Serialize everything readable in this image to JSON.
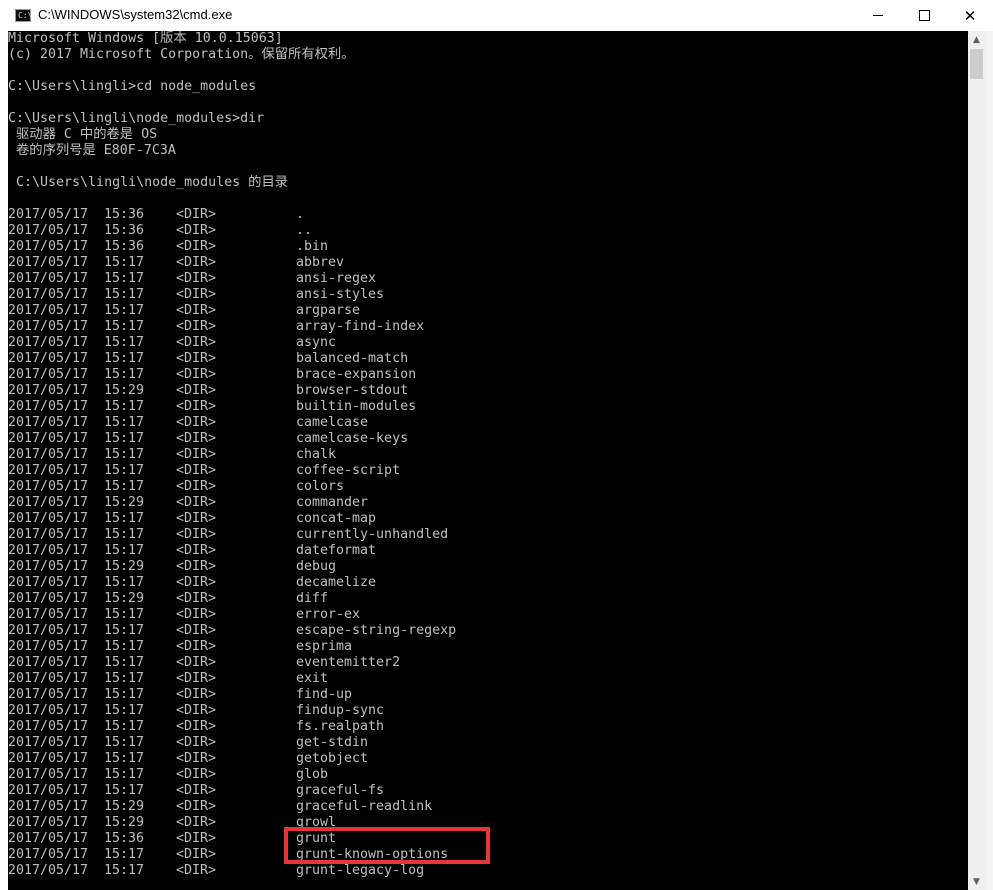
{
  "window": {
    "title": "C:\\WINDOWS\\system32\\cmd.exe",
    "icon": "cmd-icon",
    "icon_glyph": "C:\\",
    "controls": {
      "minimize": "minimize-icon",
      "maximize": "maximize-icon",
      "close": "close-icon"
    },
    "close_glyph": "✕"
  },
  "console": {
    "header_lines": [
      "Microsoft Windows [版本 10.0.15063]",
      "(c) 2017 Microsoft Corporation。保留所有权利。",
      "",
      "C:\\Users\\lingli>cd node_modules",
      "",
      "C:\\Users\\lingli\\node_modules>dir",
      " 驱动器 C 中的卷是 OS",
      " 卷的序列号是 E80F-7C3A",
      "",
      " C:\\Users\\lingli\\node_modules 的目录",
      ""
    ],
    "entries": [
      {
        "date": "2017/05/17",
        "time": "15:36",
        "type": "<DIR>",
        "name": "."
      },
      {
        "date": "2017/05/17",
        "time": "15:36",
        "type": "<DIR>",
        "name": ".."
      },
      {
        "date": "2017/05/17",
        "time": "15:36",
        "type": "<DIR>",
        "name": ".bin"
      },
      {
        "date": "2017/05/17",
        "time": "15:17",
        "type": "<DIR>",
        "name": "abbrev"
      },
      {
        "date": "2017/05/17",
        "time": "15:17",
        "type": "<DIR>",
        "name": "ansi-regex"
      },
      {
        "date": "2017/05/17",
        "time": "15:17",
        "type": "<DIR>",
        "name": "ansi-styles"
      },
      {
        "date": "2017/05/17",
        "time": "15:17",
        "type": "<DIR>",
        "name": "argparse"
      },
      {
        "date": "2017/05/17",
        "time": "15:17",
        "type": "<DIR>",
        "name": "array-find-index"
      },
      {
        "date": "2017/05/17",
        "time": "15:17",
        "type": "<DIR>",
        "name": "async"
      },
      {
        "date": "2017/05/17",
        "time": "15:17",
        "type": "<DIR>",
        "name": "balanced-match"
      },
      {
        "date": "2017/05/17",
        "time": "15:17",
        "type": "<DIR>",
        "name": "brace-expansion"
      },
      {
        "date": "2017/05/17",
        "time": "15:29",
        "type": "<DIR>",
        "name": "browser-stdout"
      },
      {
        "date": "2017/05/17",
        "time": "15:17",
        "type": "<DIR>",
        "name": "builtin-modules"
      },
      {
        "date": "2017/05/17",
        "time": "15:17",
        "type": "<DIR>",
        "name": "camelcase"
      },
      {
        "date": "2017/05/17",
        "time": "15:17",
        "type": "<DIR>",
        "name": "camelcase-keys"
      },
      {
        "date": "2017/05/17",
        "time": "15:17",
        "type": "<DIR>",
        "name": "chalk"
      },
      {
        "date": "2017/05/17",
        "time": "15:17",
        "type": "<DIR>",
        "name": "coffee-script"
      },
      {
        "date": "2017/05/17",
        "time": "15:17",
        "type": "<DIR>",
        "name": "colors"
      },
      {
        "date": "2017/05/17",
        "time": "15:29",
        "type": "<DIR>",
        "name": "commander"
      },
      {
        "date": "2017/05/17",
        "time": "15:17",
        "type": "<DIR>",
        "name": "concat-map"
      },
      {
        "date": "2017/05/17",
        "time": "15:17",
        "type": "<DIR>",
        "name": "currently-unhandled"
      },
      {
        "date": "2017/05/17",
        "time": "15:17",
        "type": "<DIR>",
        "name": "dateformat"
      },
      {
        "date": "2017/05/17",
        "time": "15:29",
        "type": "<DIR>",
        "name": "debug"
      },
      {
        "date": "2017/05/17",
        "time": "15:17",
        "type": "<DIR>",
        "name": "decamelize"
      },
      {
        "date": "2017/05/17",
        "time": "15:29",
        "type": "<DIR>",
        "name": "diff"
      },
      {
        "date": "2017/05/17",
        "time": "15:17",
        "type": "<DIR>",
        "name": "error-ex"
      },
      {
        "date": "2017/05/17",
        "time": "15:17",
        "type": "<DIR>",
        "name": "escape-string-regexp"
      },
      {
        "date": "2017/05/17",
        "time": "15:17",
        "type": "<DIR>",
        "name": "esprima"
      },
      {
        "date": "2017/05/17",
        "time": "15:17",
        "type": "<DIR>",
        "name": "eventemitter2"
      },
      {
        "date": "2017/05/17",
        "time": "15:17",
        "type": "<DIR>",
        "name": "exit"
      },
      {
        "date": "2017/05/17",
        "time": "15:17",
        "type": "<DIR>",
        "name": "find-up"
      },
      {
        "date": "2017/05/17",
        "time": "15:17",
        "type": "<DIR>",
        "name": "findup-sync"
      },
      {
        "date": "2017/05/17",
        "time": "15:17",
        "type": "<DIR>",
        "name": "fs.realpath"
      },
      {
        "date": "2017/05/17",
        "time": "15:17",
        "type": "<DIR>",
        "name": "get-stdin"
      },
      {
        "date": "2017/05/17",
        "time": "15:17",
        "type": "<DIR>",
        "name": "getobject"
      },
      {
        "date": "2017/05/17",
        "time": "15:17",
        "type": "<DIR>",
        "name": "glob"
      },
      {
        "date": "2017/05/17",
        "time": "15:17",
        "type": "<DIR>",
        "name": "graceful-fs"
      },
      {
        "date": "2017/05/17",
        "time": "15:29",
        "type": "<DIR>",
        "name": "graceful-readlink"
      },
      {
        "date": "2017/05/17",
        "time": "15:29",
        "type": "<DIR>",
        "name": "growl"
      },
      {
        "date": "2017/05/17",
        "time": "15:36",
        "type": "<DIR>",
        "name": "grunt"
      },
      {
        "date": "2017/05/17",
        "time": "15:17",
        "type": "<DIR>",
        "name": "grunt-known-options"
      },
      {
        "date": "2017/05/17",
        "time": "15:17",
        "type": "<DIR>",
        "name": "grunt-legacy-log"
      }
    ]
  },
  "scrollbar": {
    "up_glyph": "▲",
    "down_glyph": "▼"
  },
  "colors": {
    "console_bg": "#000000",
    "console_fg": "#c0c0c0",
    "highlight": "#e8353b"
  }
}
